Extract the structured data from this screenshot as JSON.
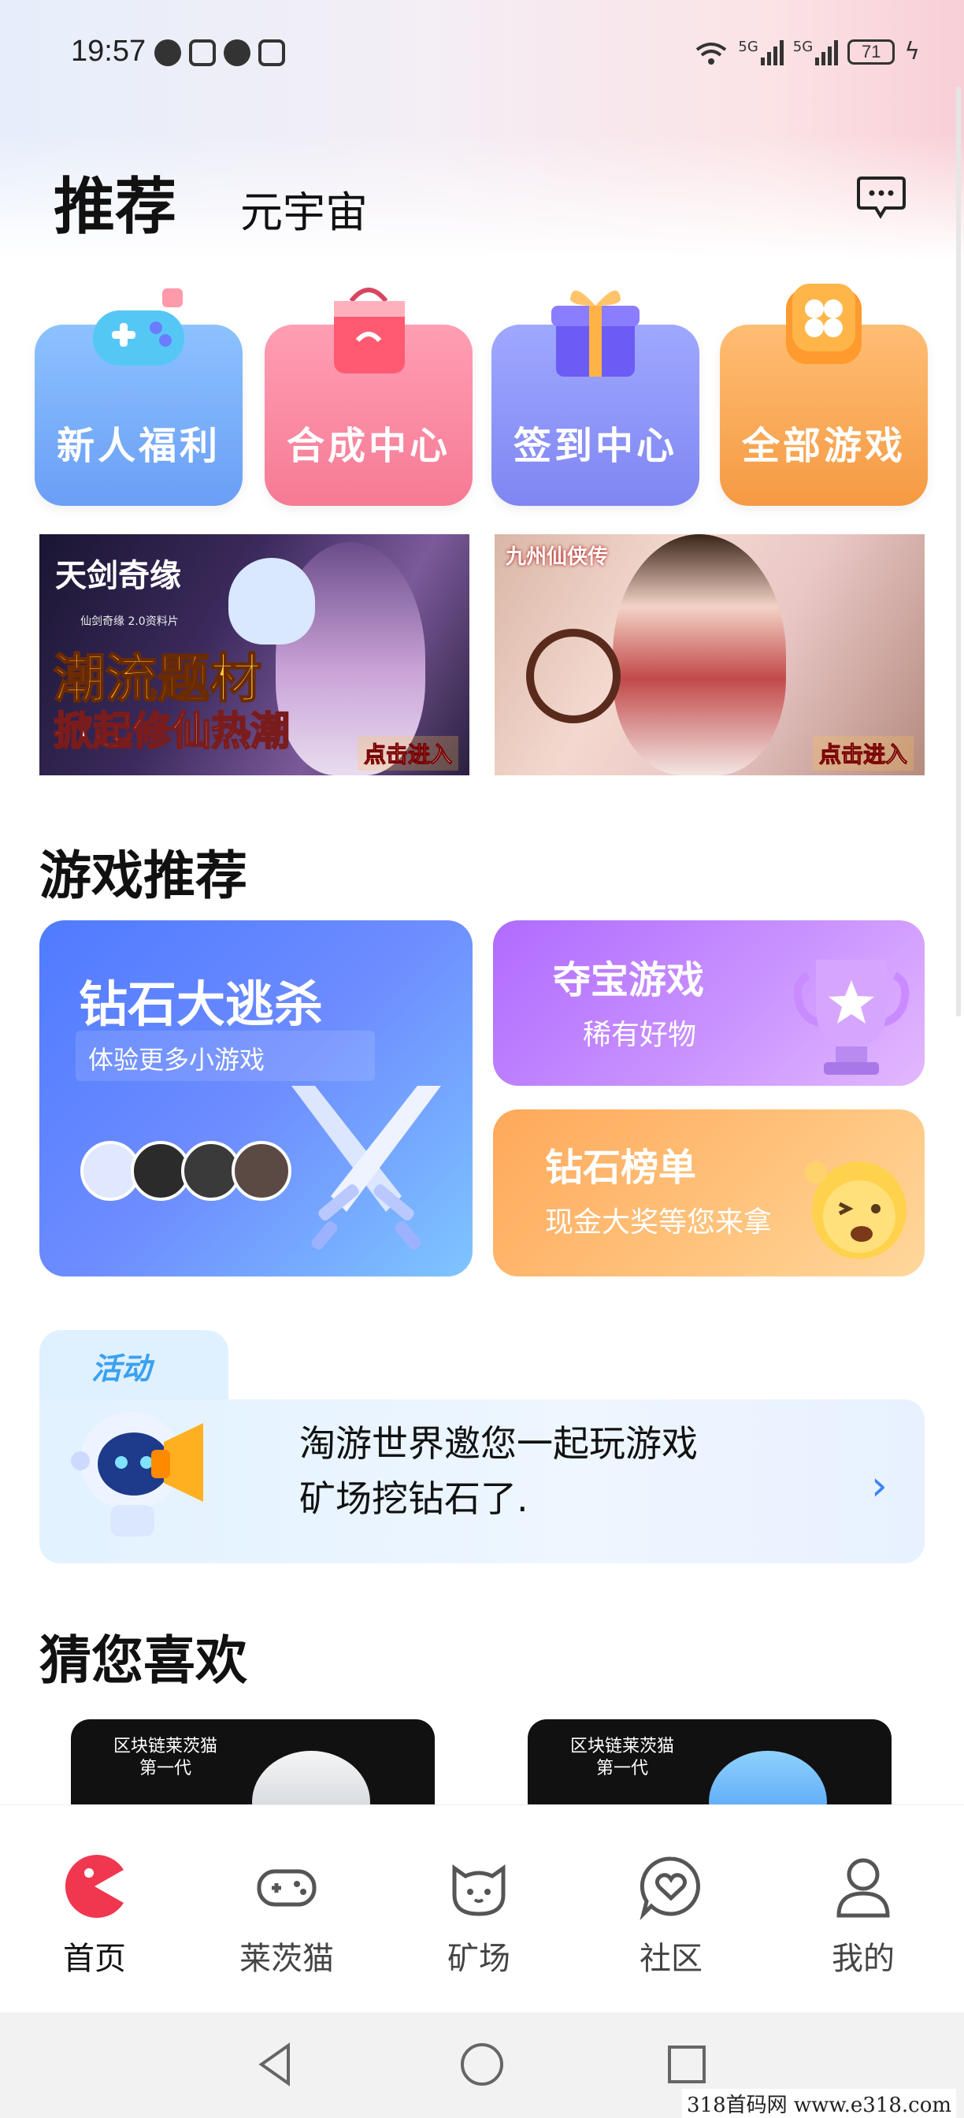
{
  "status_bar": {
    "time": "19:57",
    "network_1": "5G",
    "network_2": "5G",
    "battery": "71"
  },
  "header": {
    "tab_active": "推荐",
    "tab_other": "元宇宙",
    "message_icon": "message-icon"
  },
  "quick_entries": [
    {
      "label": "新人福利",
      "icon": "gamepad-icon",
      "color": "#6b9ef5"
    },
    {
      "label": "合成中心",
      "icon": "shopping-bag-icon",
      "color": "#f67a94"
    },
    {
      "label": "签到中心",
      "icon": "gift-box-icon",
      "color": "#7f86f2"
    },
    {
      "label": "全部游戏",
      "icon": "clover-icon",
      "color": "#f59a43"
    }
  ],
  "banners": [
    {
      "logo": "天剑奇缘",
      "logo_sub": "仙剑奇缘 2.0资料片",
      "headline": "潮流题材",
      "subline": "掀起修仙热潮",
      "enter": "点击进入"
    },
    {
      "logo": "九州仙侠传",
      "enter": "点击进入"
    }
  ],
  "game_section": {
    "title": "游戏推荐",
    "diamond_escape": {
      "title": "钻石大逃杀",
      "subtitle": "体验更多小游戏"
    },
    "treasure": {
      "title": "夺宝游戏",
      "subtitle": "稀有好物"
    },
    "ranking": {
      "title": "钻石榜单",
      "subtitle": "现金大奖等您来拿"
    }
  },
  "activity": {
    "label": "活动",
    "line1": "淘游世界邀您一起玩游戏",
    "line2": "矿场挖钻石了.",
    "chevron": "chevron-right-icon"
  },
  "guess_section": {
    "title": "猜您喜欢",
    "cards": [
      {
        "title": "区块链莱茨猫",
        "sub": "第一代"
      },
      {
        "title": "区块链莱茨猫",
        "sub": "第一代"
      }
    ]
  },
  "bottom_nav": [
    {
      "label": "首页",
      "icon": "home-pacman-icon",
      "active": true
    },
    {
      "label": "莱茨猫",
      "icon": "gamepad-outline-icon",
      "active": false
    },
    {
      "label": "矿场",
      "icon": "cat-face-icon",
      "active": false
    },
    {
      "label": "社区",
      "icon": "heart-chat-icon",
      "active": false
    },
    {
      "label": "我的",
      "icon": "user-icon",
      "active": false
    }
  ],
  "colors": {
    "accent_red": "#f0374f",
    "primary_blue": "#3b82f6"
  },
  "watermark": "318首码网 www.e318.com"
}
